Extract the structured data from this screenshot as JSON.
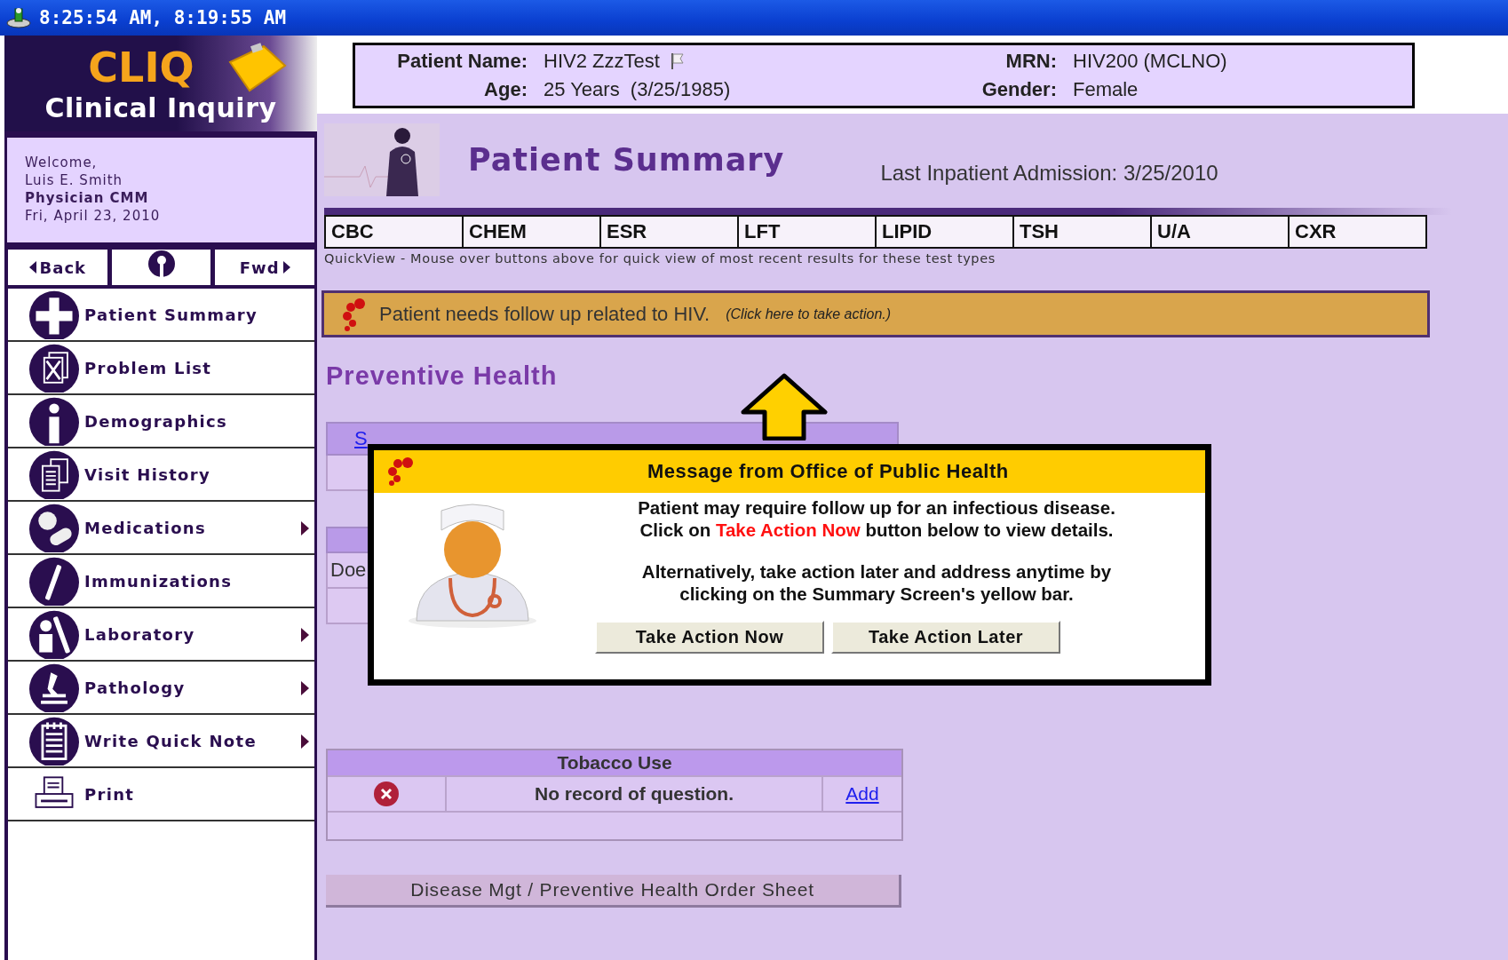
{
  "title_bar": {
    "text": "8:25:54 AM, 8:19:55 AM"
  },
  "sidebar": {
    "logo": {
      "title": "CLIQ",
      "subtitle": "Clinical Inquiry"
    },
    "welcome": {
      "greeting": "Welcome,",
      "user": "Luis E. Smith",
      "role": "Physician CMM",
      "date": "Fri, April 23, 2010"
    },
    "nav": {
      "back": "Back",
      "forward": "Fwd"
    },
    "items": [
      {
        "label": "Patient Summary",
        "has_submenu": false
      },
      {
        "label": "Problem List",
        "has_submenu": false
      },
      {
        "label": "Demographics",
        "has_submenu": false
      },
      {
        "label": "Visit History",
        "has_submenu": false
      },
      {
        "label": "Medications",
        "has_submenu": true
      },
      {
        "label": "Immunizations",
        "has_submenu": false
      },
      {
        "label": "Laboratory",
        "has_submenu": true
      },
      {
        "label": "Pathology",
        "has_submenu": true
      },
      {
        "label": "Write Quick Note",
        "has_submenu": true
      },
      {
        "label": "Print",
        "has_submenu": false
      }
    ]
  },
  "patient": {
    "fields": [
      {
        "label": "Patient Name:",
        "value": "HIV2 ZzzTest",
        "flagged": true
      },
      {
        "label": "MRN:",
        "value": "HIV200 (MCLNO)",
        "flagged": false
      },
      {
        "label": "Age:",
        "value": "25 Years  (3/25/1985)",
        "flagged": false
      },
      {
        "label": "Gender:",
        "value": "Female",
        "flagged": false
      }
    ]
  },
  "summary": {
    "title": "Patient Summary",
    "last_admission": "Last Inpatient Admission: 3/25/2010",
    "tests": [
      "CBC",
      "CHEM",
      "ESR",
      "LFT",
      "LIPID",
      "TSH",
      "U/A",
      "CXR"
    ],
    "quickview_hint": "QuickView - Mouse over buttons above for quick view of most recent results for these test types"
  },
  "alert_bar": {
    "text": "Patient needs follow up related to HIV.",
    "action": "(Click here to take action.)"
  },
  "preventive_health": {
    "title": "Preventive Health",
    "background_table": {
      "link": "S",
      "cell": "Doe"
    },
    "tobacco": {
      "title": "Tobacco Use",
      "status": "No record of question.",
      "action": "Add"
    }
  },
  "order_sheet_button": "Disease Mgt / Preventive Health Order Sheet",
  "popup": {
    "title": "Message from Office of Public Health",
    "line1": "Patient may require follow up for an infectious disease.",
    "line2_before": "Click on ",
    "line2_highlight": "Take Action Now",
    "line2_after": " button below to view details.",
    "note": "Alternatively, take action later and address anytime by clicking on the Summary Screen's yellow bar.",
    "buttons": [
      "Take Action Now",
      "Take Action Later"
    ]
  }
}
